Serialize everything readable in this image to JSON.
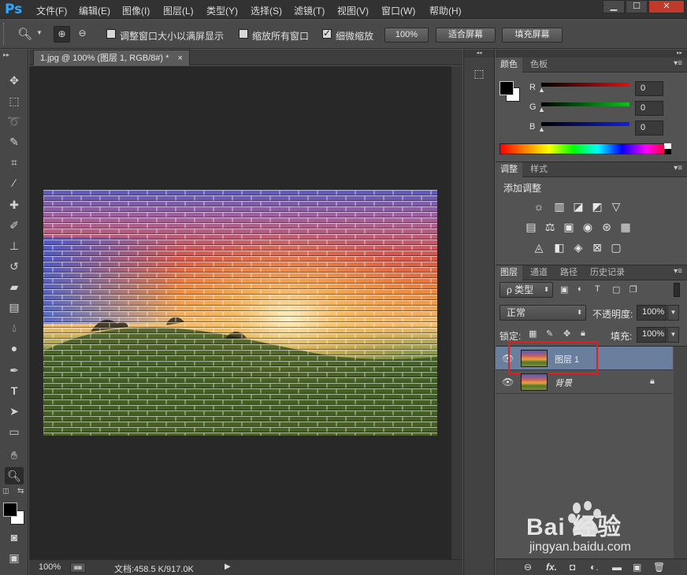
{
  "app": {
    "logo": "Ps"
  },
  "menu": [
    "文件(F)",
    "编辑(E)",
    "图像(I)",
    "图层(L)",
    "类型(Y)",
    "选择(S)",
    "滤镜(T)",
    "视图(V)",
    "窗口(W)",
    "帮助(H)"
  ],
  "window_controls": {
    "minimize": "▁",
    "maximize": "☐",
    "close": "✕"
  },
  "options": {
    "resize_windows_label": "调整窗口大小以满屏显示",
    "zoom_all_label": "缩放所有窗口",
    "scrubby_label": "细微缩放",
    "zoom_100": "100%",
    "fit_screen": "适合屏幕",
    "fill_screen": "填充屏幕"
  },
  "document": {
    "tab_title": "1.jpg @ 100% (图层 1, RGB/8#) *",
    "zoom": "100%",
    "doc_size": "文档:458.5 K/917.0K"
  },
  "color_panel": {
    "tabs": [
      "颜色",
      "色板"
    ],
    "channels": [
      {
        "label": "R",
        "value": "0",
        "color": "#e01010"
      },
      {
        "label": "G",
        "value": "0",
        "color": "#10c020"
      },
      {
        "label": "B",
        "value": "0",
        "color": "#1020e0"
      }
    ]
  },
  "adjust_panel": {
    "tabs": [
      "调整",
      "样式"
    ],
    "title": "添加调整",
    "row1": [
      "☼",
      "▥",
      "◪",
      "◩",
      "▽"
    ],
    "row2": [
      "▤",
      "⚖",
      "▣",
      "◉",
      "⊛",
      "▦"
    ],
    "row3": [
      "◬",
      "◧",
      "◈",
      "⊠",
      "▢"
    ]
  },
  "layers_panel": {
    "tabs": [
      "图层",
      "通道",
      "路径",
      "历史记录"
    ],
    "filter_kind": "ρ 类型",
    "blend_mode": "正常",
    "opacity_label": "不透明度:",
    "opacity": "100%",
    "lock_label": "锁定:",
    "fill_label": "填充:",
    "fill": "100%",
    "layers": [
      {
        "name": "图层 1",
        "selected": true,
        "locked": false
      },
      {
        "name": "背景",
        "selected": false,
        "locked": true
      }
    ],
    "footer_icons": [
      "⊖",
      "fx.",
      "◘",
      "◐.",
      "▬",
      "▣",
      "🗑"
    ]
  },
  "colors": {
    "highlight_box": "#e02020",
    "layer_selected": "#6a7e9e",
    "ps_blue": "#31a8ff"
  },
  "tools": [
    "move",
    "marquee",
    "lasso",
    "quick-select",
    "crop",
    "eyedropper",
    "healing",
    "brush",
    "stamp",
    "history-brush",
    "eraser",
    "gradient",
    "blur",
    "dodge",
    "pen",
    "type",
    "path-select",
    "shape",
    "hand",
    "zoom"
  ],
  "watermark": {
    "brand": "Bai 经验",
    "url": "jingyan.baidu.com"
  }
}
